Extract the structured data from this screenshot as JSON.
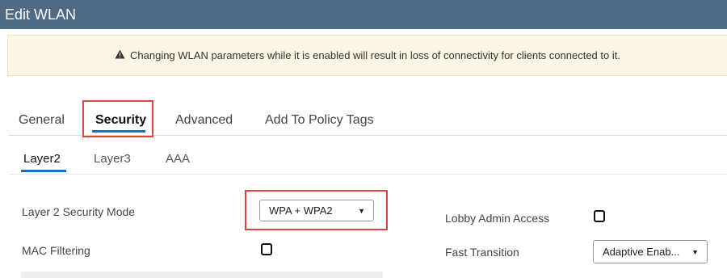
{
  "window": {
    "title": "Edit WLAN"
  },
  "warning": {
    "text": "Changing WLAN parameters while it is enabled will result in loss of connectivity for clients connected to it."
  },
  "tabs": [
    {
      "label": "General"
    },
    {
      "label": "Security",
      "active": true
    },
    {
      "label": "Advanced"
    },
    {
      "label": "Add To Policy Tags"
    }
  ],
  "subtabs": [
    {
      "label": "Layer2",
      "active": true
    },
    {
      "label": "Layer3"
    },
    {
      "label": "AAA"
    }
  ],
  "form": {
    "layer2_security_mode": {
      "label": "Layer 2 Security Mode",
      "value": "WPA + WPA2"
    },
    "mac_filtering": {
      "label": "MAC Filtering",
      "checked": false
    },
    "lobby_admin_access": {
      "label": "Lobby Admin Access",
      "checked": false
    },
    "fast_transition": {
      "label": "Fast Transition",
      "value": "Adaptive Enab..."
    }
  },
  "colors": {
    "title_bar": "#4f6a85",
    "accent": "#1f6fb8",
    "highlight": "#e0453f",
    "warning_bg": "#fbf5e3"
  },
  "icons": {
    "warning": "warning-triangle-icon",
    "dropdown": "caret-down-icon"
  }
}
